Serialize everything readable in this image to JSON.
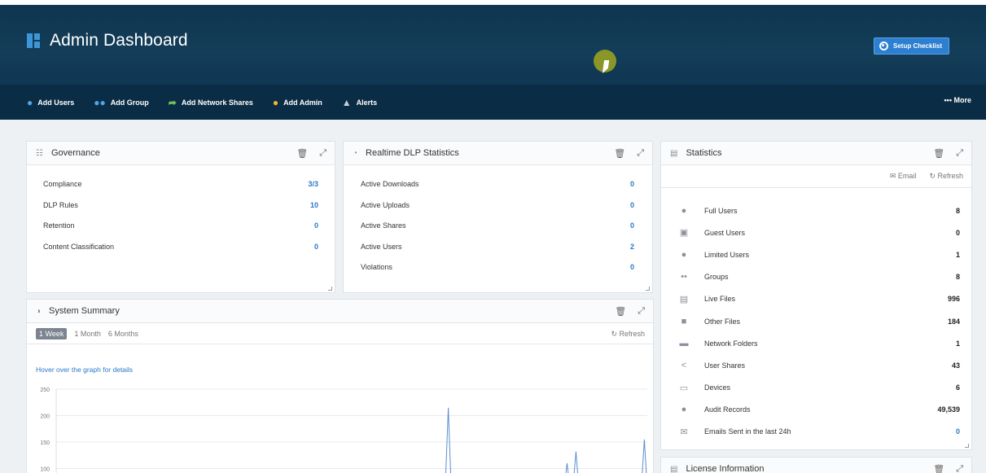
{
  "header": {
    "title": "Admin Dashboard",
    "checklist_label": "Setup Checklist"
  },
  "toolbar": {
    "items": [
      {
        "label": "Add Users",
        "icon": "user-plus-icon"
      },
      {
        "label": "Add Group",
        "icon": "group-icon"
      },
      {
        "label": "Add Network Shares",
        "icon": "share-arrow-icon"
      },
      {
        "label": "Add Admin",
        "icon": "admin-icon"
      },
      {
        "label": "Alerts",
        "icon": "bell-icon"
      }
    ],
    "more_label": "More"
  },
  "governance": {
    "title": "Governance",
    "rows": [
      {
        "label": "Compliance",
        "value": "3/3"
      },
      {
        "label": "DLP Rules",
        "value": "10"
      },
      {
        "label": "Retention",
        "value": "0"
      },
      {
        "label": "Content Classification",
        "value": "0"
      }
    ]
  },
  "dlp": {
    "title": "Realtime DLP Statistics",
    "rows": [
      {
        "label": "Active Downloads",
        "value": "0"
      },
      {
        "label": "Active Uploads",
        "value": "0"
      },
      {
        "label": "Active Shares",
        "value": "0"
      },
      {
        "label": "Active Users",
        "value": "2"
      },
      {
        "label": "Violations",
        "value": "0"
      }
    ]
  },
  "system": {
    "title": "System Summary",
    "tabs": [
      "1 Week",
      "1 Month",
      "6 Months"
    ],
    "active_tab": "1 Week",
    "refresh": "Refresh",
    "hover_note": "Hover over the graph for details"
  },
  "chart_data": {
    "type": "line",
    "yticks": [
      250,
      200,
      150,
      100
    ],
    "ylim": [
      90,
      260
    ],
    "series": [
      {
        "values": [
          0,
          0,
          0,
          0,
          0,
          0,
          0,
          0,
          0,
          0,
          0,
          0,
          0,
          0,
          0,
          0,
          0,
          0,
          0,
          0,
          0,
          0,
          0,
          0,
          0,
          0,
          0,
          0,
          0,
          0,
          0,
          0,
          0,
          0,
          0,
          0,
          0,
          0,
          0,
          0,
          0,
          0,
          0,
          0,
          0,
          0,
          0,
          0,
          0,
          0,
          0,
          0,
          0,
          0,
          0,
          0,
          0,
          0,
          0,
          0,
          0,
          0,
          0,
          0,
          0,
          0,
          0,
          0,
          0,
          0,
          0,
          0,
          0,
          0,
          0,
          0,
          0,
          0,
          0,
          0,
          0,
          0,
          0,
          0,
          0,
          0,
          0,
          0,
          0,
          0,
          0,
          0,
          0,
          0,
          0,
          0,
          0,
          0,
          0,
          0,
          0,
          0,
          0,
          0,
          0,
          0,
          0,
          0,
          0,
          0,
          0,
          0,
          0,
          0,
          0,
          0,
          0,
          0,
          0,
          0,
          0,
          0,
          0,
          0,
          0,
          0,
          0,
          0,
          0,
          0,
          0,
          0,
          215,
          60,
          0,
          0,
          0,
          0,
          0,
          0,
          0,
          0,
          0,
          0,
          0,
          0,
          0,
          0,
          0,
          0,
          0,
          0,
          0,
          0,
          0,
          0,
          0,
          0,
          0,
          0,
          0,
          0,
          0,
          0,
          0,
          0,
          0,
          0,
          0,
          0,
          0,
          0,
          110,
          60,
          0,
          132,
          60,
          0,
          0,
          0,
          0,
          0,
          0,
          0,
          0,
          0,
          0,
          0,
          0,
          0,
          0,
          0,
          0,
          0,
          0,
          0,
          0,
          0,
          155,
          60
        ]
      }
    ]
  },
  "statistics": {
    "title": "Statistics",
    "email": "Email",
    "refresh": "Refresh",
    "rows": [
      {
        "label": "Full Users",
        "value": "8",
        "icon": "user-icon"
      },
      {
        "label": "Guest Users",
        "value": "0",
        "icon": "guest-badge-icon"
      },
      {
        "label": "Limited Users",
        "value": "1",
        "icon": "limited-user-icon"
      },
      {
        "label": "Groups",
        "value": "8",
        "icon": "groups-icon"
      },
      {
        "label": "Live Files",
        "value": "996",
        "icon": "file-text-icon"
      },
      {
        "label": "Other Files",
        "value": "184",
        "icon": "file-icon"
      },
      {
        "label": "Network Folders",
        "value": "1",
        "icon": "folder-icon"
      },
      {
        "label": "User Shares",
        "value": "43",
        "icon": "share-icon"
      },
      {
        "label": "Devices",
        "value": "6",
        "icon": "laptop-icon"
      },
      {
        "label": "Audit Records",
        "value": "49,539",
        "icon": "audit-user-icon"
      },
      {
        "label": "Emails Sent in the last 24h",
        "value": "0",
        "icon": "envelope-icon",
        "blue": true
      }
    ]
  },
  "license": {
    "title": "License Information"
  }
}
